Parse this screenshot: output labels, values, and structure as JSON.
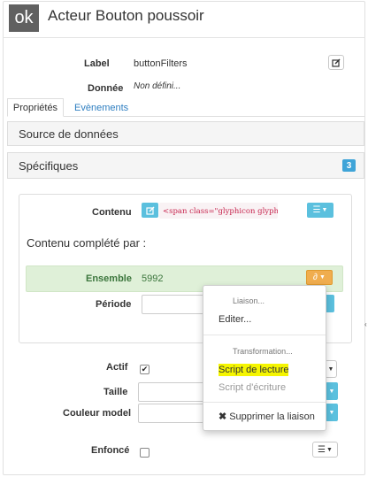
{
  "header": {
    "badge": "ok",
    "title": "Acteur Bouton poussoir"
  },
  "fields": {
    "label_key": "Label",
    "label_value": "buttonFilters",
    "donnee_key": "Donnée",
    "donnee_value": "Non défini..."
  },
  "tabs": [
    {
      "label": "Propriétés"
    },
    {
      "label": "Evènements"
    }
  ],
  "sections": {
    "source": "Source de données",
    "specifiques": "Spécifiques",
    "specifiques_count": "3"
  },
  "contenu": {
    "label": "Contenu",
    "value": "<span class=\"glyphicon glyphi...",
    "complete_label": "Contenu complété par :"
  },
  "ensemble": {
    "label": "Ensemble",
    "value": "5992"
  },
  "periode": {
    "label": "Période",
    "value": ""
  },
  "lower": {
    "actif": "Actif",
    "taille": "Taille",
    "couleur": "Couleur model",
    "enfonce": "Enfoncé"
  },
  "menu": {
    "header1": "Liaison...",
    "edit": "Editer...",
    "header2": "Transformation...",
    "read_script": "Script de lecture",
    "write_script": "Script d'écriture",
    "delete": "Supprimer la liaison"
  },
  "colors": {
    "accent": "#5bc0de",
    "success_bg": "#dff0d8",
    "warning": "#f0ad4e",
    "highlight": "#f5f500"
  },
  "icons": [
    "edit-icon",
    "list-icon",
    "link-icon",
    "close-icon",
    "caret-down-icon",
    "check-icon"
  ]
}
